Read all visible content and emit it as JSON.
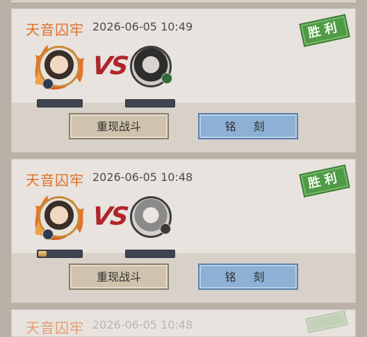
{
  "records": [
    {
      "location": "天音囚牢",
      "time": "2026-06-05 10:49",
      "result": "胜利",
      "vs": "VS",
      "replay_label": "重现战斗",
      "inscribe_label": "铭 刻",
      "player_progress": 0.0,
      "opponent_progress": 0.0
    },
    {
      "location": "天音囚牢",
      "time": "2026-06-05 10:48",
      "result": "胜利",
      "vs": "VS",
      "replay_label": "重现战斗",
      "inscribe_label": "铭 刻",
      "player_progress": 0.18,
      "opponent_progress": 0.0
    },
    {
      "location": "天音囚牢",
      "time": "2026-06-05 10:48"
    }
  ],
  "colors": {
    "location_text": "#e06f2b",
    "victory_stamp": "#4f9a47",
    "vs_text": "#b0262a",
    "replay_button": "#d0c3ad",
    "inscribe_button": "#8db0d4"
  },
  "icons": {
    "player_avatar": "player-portrait-icon",
    "opponent_avatar": "opponent-portrait-icon",
    "flame_frame": "flame-frame-icon",
    "element_badge": "element-badge-icon"
  }
}
